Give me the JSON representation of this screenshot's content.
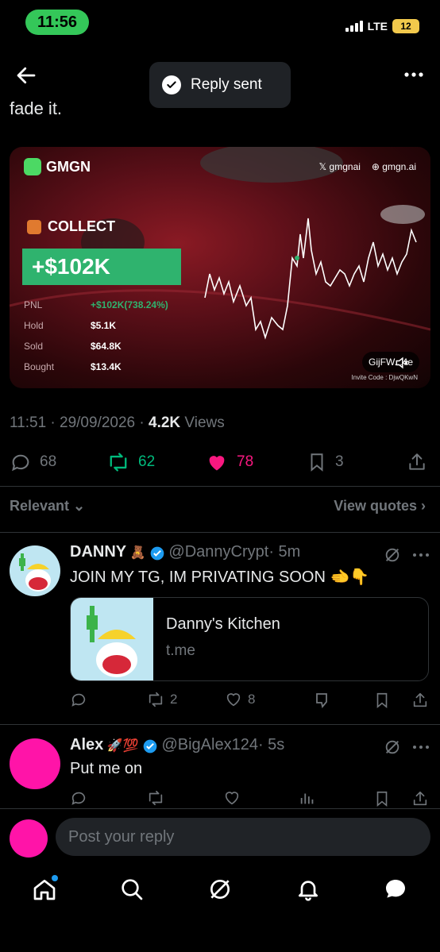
{
  "status_bar": {
    "time": "11:56",
    "network": "LTE",
    "battery": "12"
  },
  "toast": {
    "text": "Reply sent"
  },
  "tweet": {
    "text": "fade it.",
    "media": {
      "brand": "GMGN",
      "social_x": "gmgnai",
      "social_web": "gmgn.ai",
      "collect_label": "COLLECT",
      "profit": "+$102K",
      "stats": [
        {
          "label": "PNL",
          "value": "+$102K(738.24%)"
        },
        {
          "label": "Hold",
          "value": "$5.1K"
        },
        {
          "label": "Sold",
          "value": "$64.8K"
        },
        {
          "label": "Bought",
          "value": "$13.4K"
        }
      ],
      "handle_pill": "GijFW...4e",
      "invite_code": "Invite Code : DjwQKwN"
    },
    "timestamp": "11:51 · 29/09/2026 · ",
    "views_count": "4.2K",
    "views_label": " Views",
    "actions": {
      "replies": "68",
      "reposts": "62",
      "likes": "78",
      "bookmarks": "3"
    }
  },
  "filter": {
    "relevant": "Relevant",
    "view_quotes": "View quotes"
  },
  "replies": [
    {
      "name": "DANNY",
      "name_emoji": "🧸",
      "handle": "@DannyCrypt",
      "time": "· 5m",
      "text": "JOIN MY TG, IM PRIVATING SOON 🫲👇",
      "link_card": {
        "title": "Danny's Kitchen",
        "domain": "t.me"
      },
      "reposts": "2",
      "likes": "8"
    },
    {
      "name": "Alex",
      "name_emoji": "🚀💯",
      "handle": "@BigAlex124",
      "time": "· 5s",
      "text": "Put me on"
    }
  ],
  "compose": {
    "placeholder": "Post your reply"
  },
  "colors": {
    "accent": "#1d9bf0",
    "like": "#f91880",
    "repost": "#00ba7c",
    "green_profit": "#2fb36e"
  }
}
